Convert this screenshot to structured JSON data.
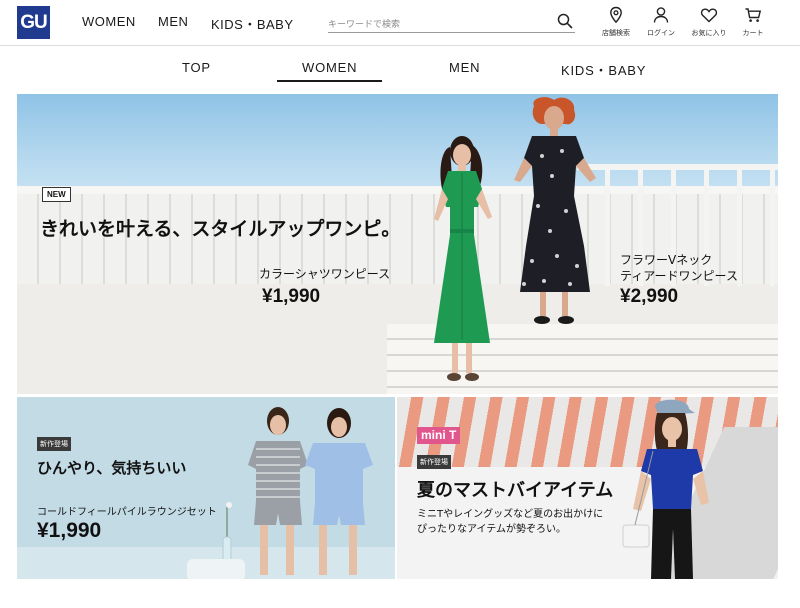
{
  "header": {
    "logo": "GU",
    "nav": [
      "WOMEN",
      "MEN",
      "KIDS・BABY"
    ],
    "search_placeholder": "キーワードで検索",
    "utilities": [
      {
        "label": "店舗検索",
        "icon": "location-pin-icon"
      },
      {
        "label": "ログイン",
        "icon": "user-icon"
      },
      {
        "label": "お気に入り",
        "icon": "heart-icon"
      },
      {
        "label": "カート",
        "icon": "cart-icon"
      }
    ]
  },
  "tabs": {
    "items": [
      "TOP",
      "WOMEN",
      "MEN",
      "KIDS・BABY"
    ],
    "active": "WOMEN"
  },
  "hero": {
    "badge": "NEW",
    "headline": "きれいを叶える、スタイルアップワンピ。",
    "product1": {
      "name": "カラーシャツワンピース",
      "price": "¥1,990"
    },
    "product2": {
      "name_line1": "フラワーVネック",
      "name_line2": "ティアードワンピース",
      "price": "¥2,990"
    }
  },
  "tile_left": {
    "tag": "新作登場",
    "headline": "ひんやり、気持ちいい",
    "product": "コールドフィールパイルラウンジセット",
    "price": "¥1,990"
  },
  "tile_right": {
    "brand_tag": "mini T",
    "tag": "新作登場",
    "headline": "夏のマストバイアイテム",
    "line1": "ミニTやレイングッズなど夏のお出かけに",
    "line2": "ぴったりなアイテムが勢ぞろい。"
  },
  "colors": {
    "logo_bg": "#1f3a8f",
    "minit_pink": "#e2568e",
    "green_dress": "#1f9a52",
    "lounge_stripe": "#9aa0a6",
    "lounge_blue": "#9fbfe6",
    "top_blue": "#1d3aa8"
  }
}
